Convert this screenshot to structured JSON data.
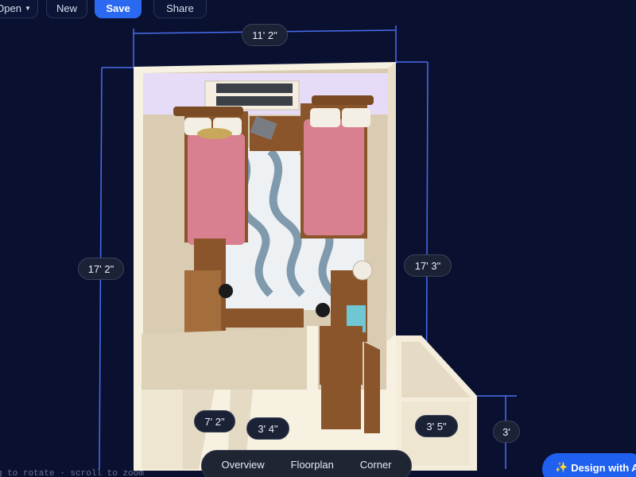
{
  "toolbar": {
    "open_label": "Open",
    "new_label": "New",
    "save_label": "Save",
    "share_label": "Share"
  },
  "dimensions": {
    "room_width": "11' 2\"",
    "room_left_length": "17' 2\"",
    "room_right_length": "17' 3\"",
    "closet_width": "7' 2\"",
    "closet_depth": "3' 4\"",
    "alcove_width": "3' 5\"",
    "alcove_depth": "3'"
  },
  "views": {
    "overview": "Overview",
    "floorplan": "Floorplan",
    "corner": "Corner"
  },
  "hint_text": "g to rotate · scroll to zoom",
  "ai_button": {
    "icon": "sparkles-icon",
    "label": "Design with AI"
  },
  "colors": {
    "background": "#0a1130",
    "accent": "#2b6af0",
    "dimension_line": "#4a6cf0",
    "wall": "#f7f1e2",
    "floor": "#d9ccb3",
    "wood": "#8a552b",
    "bedding": "#d98090",
    "rug_light": "#eef1f4",
    "rug_pattern": "#7f99ad",
    "ceiling_tint": "#e7dcf7"
  }
}
